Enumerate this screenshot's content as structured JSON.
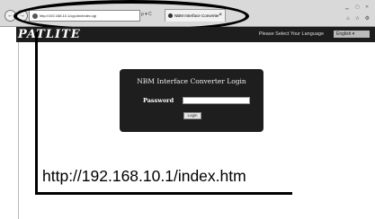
{
  "browser": {
    "back_glyph": "←",
    "forward_glyph": "→",
    "address": "http://192.168.10.1/cgi-bin/index.cgi",
    "address_tools": "ρ ▾ C",
    "tab_title": "NBM Interface Converter",
    "tab_close": "×",
    "toolbar_icons": "⌂ ☆ ⚙"
  },
  "header": {
    "logo_text": "PATLITE",
    "language_label": "Please Select Your Language",
    "language_value": "English"
  },
  "login": {
    "title": "NBM Interface Converter Login",
    "password_label": "Password",
    "password_value": "",
    "button_label": "Login"
  },
  "annotation": {
    "url_caption": "http://192.168.10.1/index.htm"
  }
}
